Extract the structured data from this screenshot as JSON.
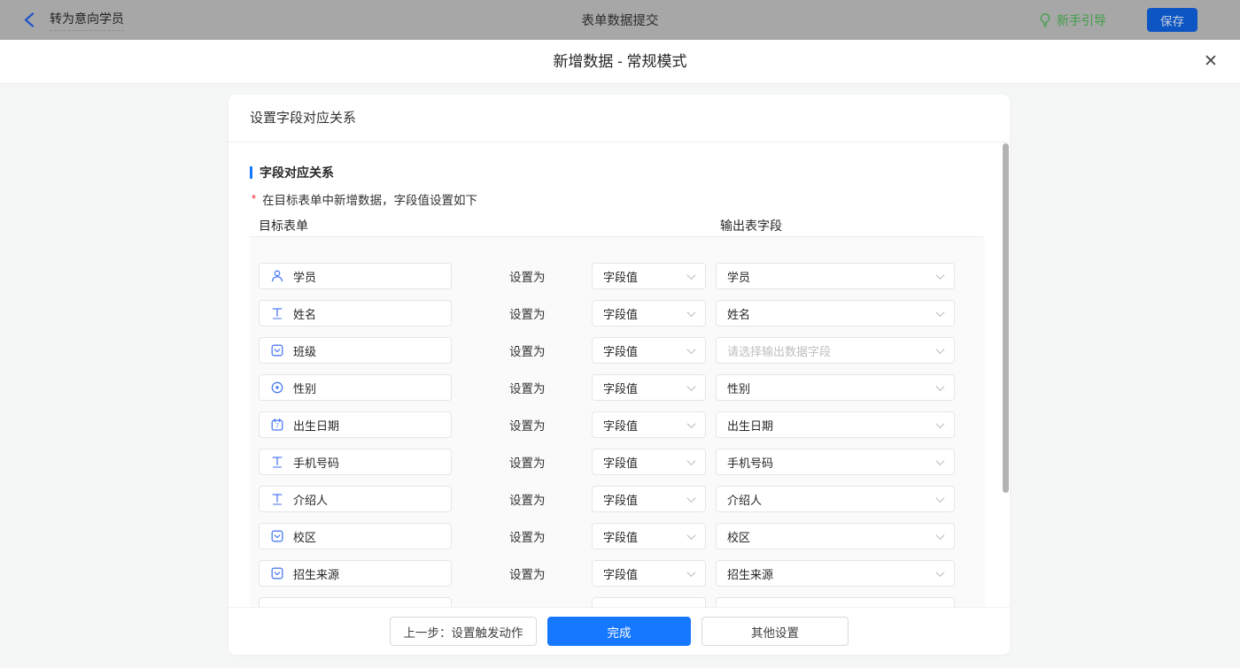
{
  "topbar": {
    "back_label": "转为意向学员",
    "title": "表单数据提交",
    "guide_label": "新手引导",
    "save_label": "保存"
  },
  "modal": {
    "title": "新增数据 - 常规模式",
    "close_glyph": "✕"
  },
  "card": {
    "header_title": "设置字段对应关系",
    "section_title": "字段对应关系",
    "required_mark": "*",
    "note": "在目标表单中新增数据，字段值设置如下",
    "column_left": "目标表单",
    "column_right": "输出表字段",
    "set_as_label": "设置为",
    "rows": [
      {
        "field": "学员",
        "icon": "person",
        "method": "字段值",
        "output": "学员",
        "placeholder": false
      },
      {
        "field": "姓名",
        "icon": "text",
        "method": "字段值",
        "output": "姓名",
        "placeholder": false
      },
      {
        "field": "班级",
        "icon": "select",
        "method": "字段值",
        "output": "请选择输出数据字段",
        "placeholder": true
      },
      {
        "field": "性别",
        "icon": "radio",
        "method": "字段值",
        "output": "性别",
        "placeholder": false
      },
      {
        "field": "出生日期",
        "icon": "date",
        "method": "字段值",
        "output": "出生日期",
        "placeholder": false
      },
      {
        "field": "手机号码",
        "icon": "text",
        "method": "字段值",
        "output": "手机号码",
        "placeholder": false
      },
      {
        "field": "介绍人",
        "icon": "text",
        "method": "字段值",
        "output": "介绍人",
        "placeholder": false
      },
      {
        "field": "校区",
        "icon": "select",
        "method": "字段值",
        "output": "校区",
        "placeholder": false
      },
      {
        "field": "招生来源",
        "icon": "select",
        "method": "字段值",
        "output": "招生来源",
        "placeholder": false
      },
      {
        "field": "",
        "icon": "none",
        "method": "",
        "output": "",
        "placeholder": false
      }
    ]
  },
  "footer": {
    "prev_label": "上一步：设置触发动作",
    "done_label": "完成",
    "other_label": "其他设置"
  },
  "colors": {
    "accent_blue": "#1677ff",
    "field_icon_blue": "#4d7bf3",
    "guide_green": "#3f9e48",
    "required_red": "#f5222d",
    "topbar_bg": "#a7a7a7",
    "save_button_bg": "#0d55c3",
    "placeholder_gray": "#bfbfbf",
    "scrollbar_gray": "#b3b3b3"
  }
}
